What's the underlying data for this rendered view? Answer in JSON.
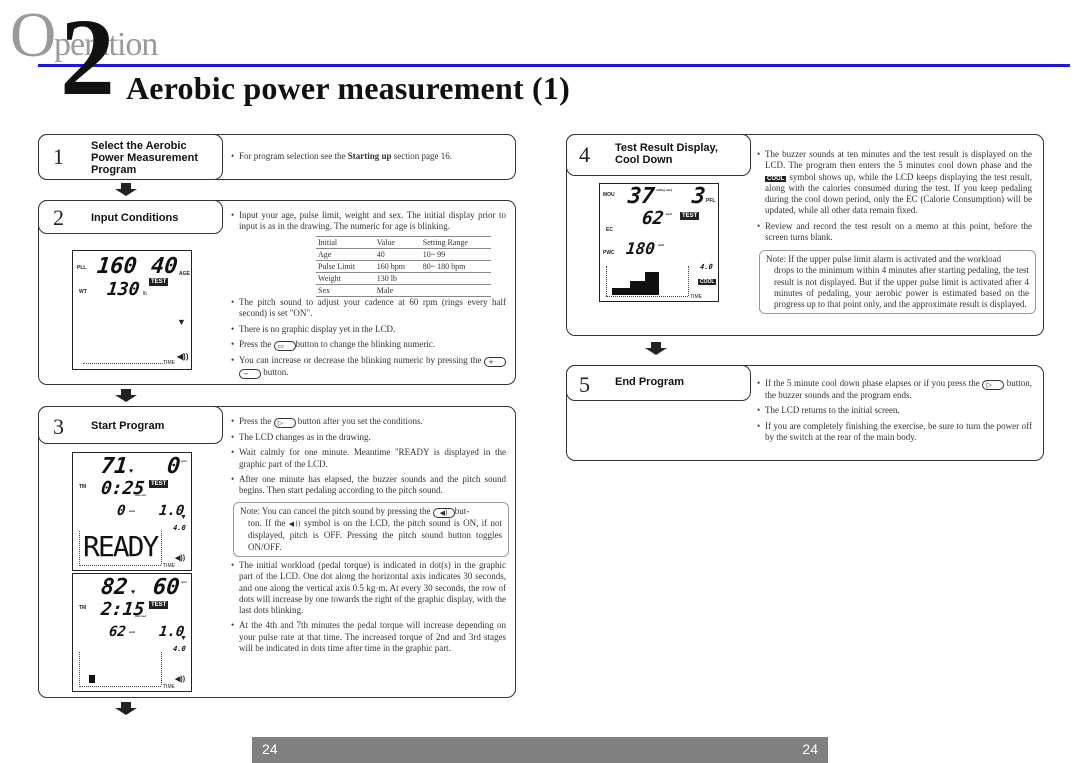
{
  "header": {
    "section_initial": "O",
    "section_rest": "peration",
    "chapter_number": "2",
    "title": "Aerobic power measurement (1)"
  },
  "steps": [
    {
      "number": "1",
      "title_lines": [
        "Select the Aerobic",
        "Power Measurement",
        "Program"
      ],
      "bullets": [
        {
          "pre": "For program selection see the ",
          "bold": "Starting up",
          "post": " section page 16."
        }
      ]
    },
    {
      "number": "2",
      "title": "Input Conditions",
      "intro": "Input your age, pulse limit, weight and sex. The initial display prior to input is as in the drawing. The numeric for age is blinking.",
      "table": {
        "headers": [
          "Initial",
          "Value",
          "Setting Range"
        ],
        "rows": [
          [
            "Age",
            "40",
            "10~ 99"
          ],
          [
            "Pulse Limit",
            "160 bpm",
            "80~ 180 bpm"
          ],
          [
            "Weight",
            "130 lb",
            ""
          ],
          [
            "Sex",
            "Male",
            ""
          ]
        ]
      },
      "bullets": [
        "The pitch sound to adjust your cadence at 60 rpm (rings every half second) is set \"ON\".",
        "There is no graphic display yet in the LCD."
      ],
      "press_pre": "Press the",
      "press_post": "button to change the blinking numeric.",
      "incdec_text": "You can increase or decrease the blinking numeric by pressing the",
      "incdec_post": "button.",
      "lcd": {
        "pll_label": "PLL",
        "pll_value": "160",
        "age_value": "40",
        "age_label": "AGE",
        "wt_label": "WT",
        "wt_value": "130",
        "wt_unit": "lb",
        "test_tag": "TEST",
        "time_label": "TIME"
      }
    },
    {
      "number": "3",
      "title": "Start Program",
      "press_pre": "Press the",
      "press_post": "button after you set the conditions.",
      "bullets": [
        "The LCD changes as in the drawing.",
        "Wait calmly for one minute. Meantime \"READY is displayed in the graphic part of the LCD.",
        "After one minute has elapsed, the buzzer sounds and the pitch sound begins. Then start pedaling according to the pitch sound."
      ],
      "note": {
        "line1_pre": "Note: You can cancel the pitch sound by pressing the",
        "line1_post": "but-",
        "line2_pre": "ton. If the",
        "line2_post": "symbol is on the LCD, the pitch sound is ON, if not displayed, pitch is OFF. Pressing the pitch sound button toggles ON/OFF."
      },
      "bullets2": [
        "The initial workload (pedal torque) is indicated in dot(s) in the graphic part of the LCD. One dot along the horizontal axis indicates 30 seconds, and one along the vertical axis 0.5 kg·m. At every 30 seconds, the row of dots will increase by one towards the right of the graphic display, with the last dots blinking.",
        "At the 4th and 7th minutes the pedal torque will increase depending on your pulse rate at that time. The increased torque of 2nd and 3rd stages will be indicated in dots time after time in the graphic part."
      ],
      "lcd_a": {
        "pulse": "71",
        "rpm": "0",
        "rpm_unit": "rpm",
        "tm_label": "TM",
        "time": "0:25",
        "time_unit": "min:sec",
        "watt": "0",
        "watt_unit": "watt",
        "torque": "1.0",
        "torque_unit": "kg·m",
        "max_torque": "4.0",
        "graphic_text": "READY",
        "test_tag": "TEST",
        "time_label": "TIME"
      },
      "lcd_b": {
        "pulse": "82",
        "rpm": "60",
        "rpm_unit": "rpm",
        "tm_label": "TM",
        "time": "2:15",
        "time_unit": "min:sec",
        "watt": "62",
        "watt_unit": "watt",
        "torque": "1.0",
        "torque_unit": "kg·m",
        "max_torque": "4.0",
        "test_tag": "TEST",
        "time_label": "TIME"
      }
    },
    {
      "number": "4",
      "title_lines": [
        "Test Result Display,",
        "Cool Down"
      ],
      "bullets_pre": "The buzzer sounds at ten minutes and the test result is displayed on the LCD. The program then enters the 5 minutes cool down phase and the",
      "cool_tag": "COOL",
      "bullets_post": "symbol shows up, while the LCD keeps displaying the test result, along with the calories consumed during the test. If you keep pedaling during the cool down period, only the EC (Calorie Consumption) will be updated, while all other data remain fixed.",
      "bullets": [
        "Review and record the test result on a memo at this point, before the screen turns blank."
      ],
      "note_first": "Note: If the upper pulse limit alarm is activated and the workload",
      "note_rest": "drops to the minimum within 4 minutes after starting pedaling, the test result is not displayed. But if the upper pulse limit is activated after 4 minutes of pedaling, your aerobic power is estimated based on the progress up to that point only, and the approximate result is displayed.",
      "lcd": {
        "mou_label": "MOU",
        "mou_value": "37",
        "mou_unit": "ml/(kg·min)",
        "pfl_value": "3",
        "pfl_label": "PFL",
        "ec_label": "EC",
        "ec_value": "62",
        "ec_unit": "kcal",
        "pwc_label": "PWC",
        "pwc_value": "180",
        "pwc_unit": "watt",
        "max_torque": "4.0",
        "test_tag": "TEST",
        "cool_tag": "COOL",
        "time_label": "TIME"
      }
    },
    {
      "number": "5",
      "title": "End Program",
      "press_pre": "If the 5 minute cool down phase elapses or if you press the",
      "press_post": "button, the buzzer sounds and the program ends.",
      "bullets": [
        "The LCD returns to the initial screen.",
        "If you are completely finishing the exercise, be sure to turn the power off by the switch at the rear of the main body."
      ]
    }
  ],
  "footer": {
    "page_left": "24",
    "page_right": "24"
  }
}
